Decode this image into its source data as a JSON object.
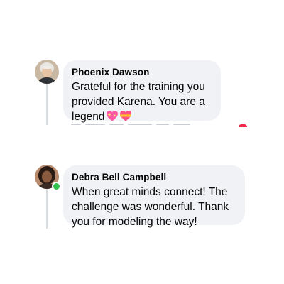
{
  "comments": [
    {
      "author": "Phoenix Dawson",
      "text_line1": "Grateful for the training you",
      "text_line2": "provided Karena. You are a",
      "text_line3": "legend",
      "emojis": [
        "sparkling-heart-icon",
        "heart-with-ribbon-icon"
      ],
      "online": false
    },
    {
      "author": "Debra Bell Campbell",
      "text_line1": "When great minds connect! The",
      "text_line2": "challenge was wonderful. Thank",
      "text_line3": "you for modeling the way!",
      "online": true
    }
  ],
  "colors": {
    "bubble": "#f0f2f5",
    "text": "#050505",
    "online": "#31c24d",
    "thread_line": "#d9dce1"
  }
}
